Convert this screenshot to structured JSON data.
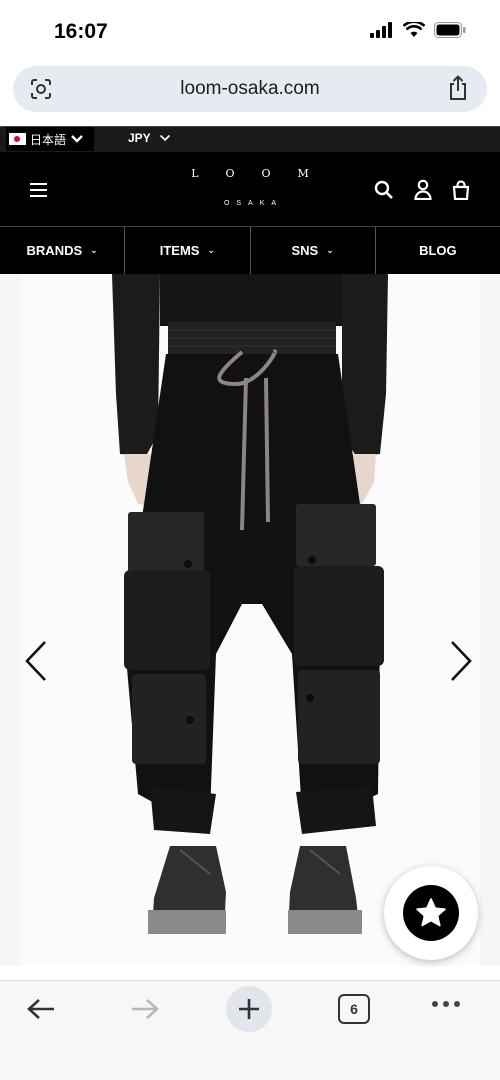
{
  "status_bar": {
    "time": "16:07"
  },
  "browser": {
    "url": "loom-osaka.com",
    "open_tabs": "6"
  },
  "top_bar": {
    "language": "日本語",
    "currency": "JPY"
  },
  "header": {
    "logo": "LOOM",
    "logo_sub": "OSAKA"
  },
  "nav": [
    {
      "label": "BRANDS",
      "has_dropdown": true
    },
    {
      "label": "ITEMS",
      "has_dropdown": true
    },
    {
      "label": "SNS",
      "has_dropdown": true
    },
    {
      "label": "BLOG",
      "has_dropdown": false
    }
  ],
  "colors": {
    "header_bg": "#000000",
    "url_bar_bg": "#e6ebf1",
    "flag_red": "#c8102e"
  },
  "icons": [
    "lens-icon",
    "share-icon",
    "menu-icon",
    "search-icon",
    "account-icon",
    "cart-icon",
    "chevron-left-icon",
    "chevron-right-icon",
    "star-icon",
    "back-icon",
    "forward-icon",
    "plus-icon",
    "more-icon"
  ]
}
